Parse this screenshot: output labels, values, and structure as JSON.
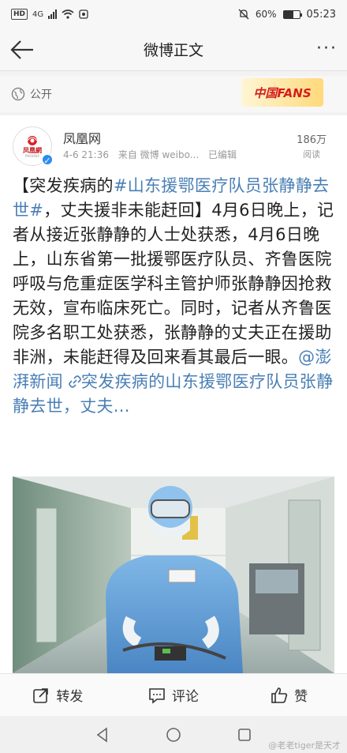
{
  "status_bar": {
    "network": "4G",
    "battery": "60%",
    "time": "05:23"
  },
  "nav": {
    "title": "微博正文"
  },
  "visibility": {
    "label": "公开",
    "badge": "中国FANS"
  },
  "post": {
    "author": "凤凰网",
    "avatar_logo": "凤凰網",
    "avatar_logo_sub": "PHOENIX",
    "date": "4-6 21:36",
    "source": "来自 微博 weibo...",
    "edited": "已编辑",
    "reads": "186万",
    "reads_label": "阅读",
    "body_prefix": "【突发疾病的",
    "hashtag": "#山东援鄂医疗队员张静静去世#",
    "body_main": "，丈夫援非未能赶回】4月6日晚上，记者从接近张静静的人士处获悉，4月6日晚上，山东省第一批援鄂医疗队员、齐鲁医院呼吸与危重症医学科主管护师张静静因抢救无效，宣布临床死亡。同时，记者从齐鲁医院多名职工处获悉，张静静的丈夫正在援助非洲，未能赶得及回来看其最后一眼。",
    "mention": "@澎湃新闻",
    "link_text": "突发疾病的山东援鄂医疗队员张静静去世，丈夫..."
  },
  "actions": {
    "repost": "转发",
    "comment": "评论",
    "like": "赞"
  },
  "watermark": "@老老tiger是天才"
}
